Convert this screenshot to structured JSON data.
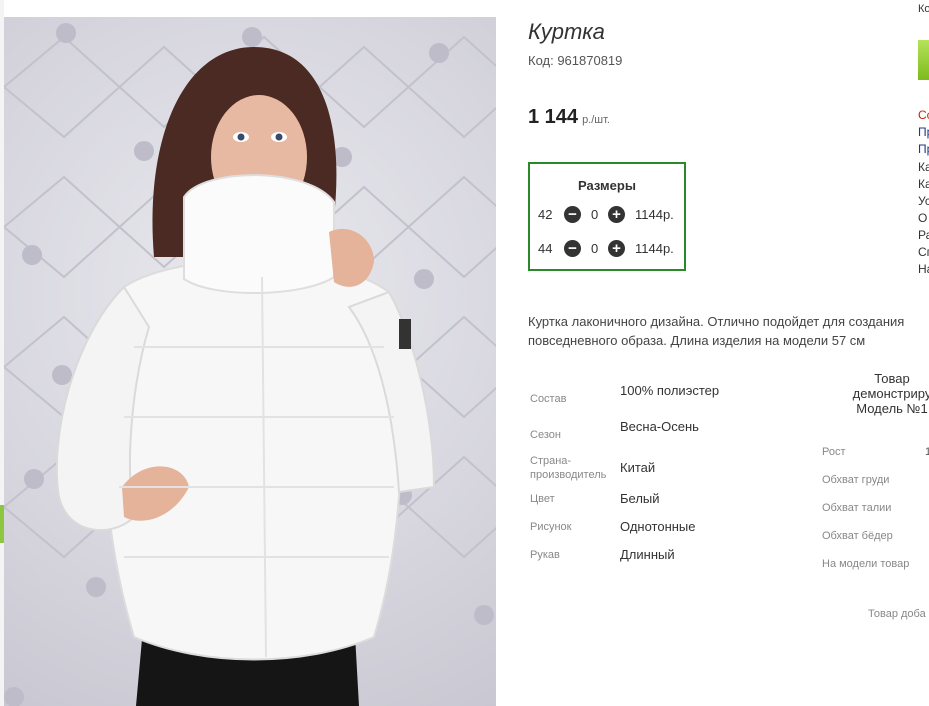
{
  "product": {
    "title": "Куртка",
    "code": "Код: 961870819",
    "price": "1 144",
    "price_unit": "р./шт."
  },
  "sizes": {
    "header": "Размеры",
    "rows": [
      {
        "size": "42",
        "qty": "0",
        "price": "1144р."
      },
      {
        "size": "44",
        "qty": "0",
        "price": "1144р."
      }
    ]
  },
  "description": "Куртка лаконичного дизайна. Отлично подойдет для создания повседневного образа. Длина изделия на модели 57 см",
  "properties": [
    {
      "label": "Состав",
      "value": "100% полиэстер"
    },
    {
      "label": "Сезон",
      "value": "Весна-Осень"
    },
    {
      "label": "Страна-производитель",
      "value": "Китай"
    },
    {
      "label": "Цвет",
      "value": "Белый"
    },
    {
      "label": "Рисунок",
      "value": "Однотонные"
    },
    {
      "label": "Рукав",
      "value": "Длинный"
    }
  ],
  "model": {
    "header_1": "Товар",
    "header_2": "демонстриру",
    "header_3": "Модель №1",
    "rows": [
      {
        "label": "Рост",
        "value": "1"
      },
      {
        "label": "Обхват груди",
        "value": ""
      },
      {
        "label": "Обхват талии",
        "value": ""
      },
      {
        "label": "Обхват бёдер",
        "value": ""
      },
      {
        "label": "На модели товар",
        "value": ""
      }
    ]
  },
  "added_text": "Товар доба",
  "right_edge": {
    "top": "Ко",
    "links": [
      "Сс",
      "Пр",
      "Пр",
      "Ка",
      "Ка",
      "Ус",
      "О",
      "Ра",
      "Сп",
      "На"
    ]
  },
  "colors": {
    "sizes_border": "#2a8a2a",
    "accent_green": "#8dc63f",
    "link_red": "#cc2200",
    "link_blue": "#1a3a8a"
  }
}
